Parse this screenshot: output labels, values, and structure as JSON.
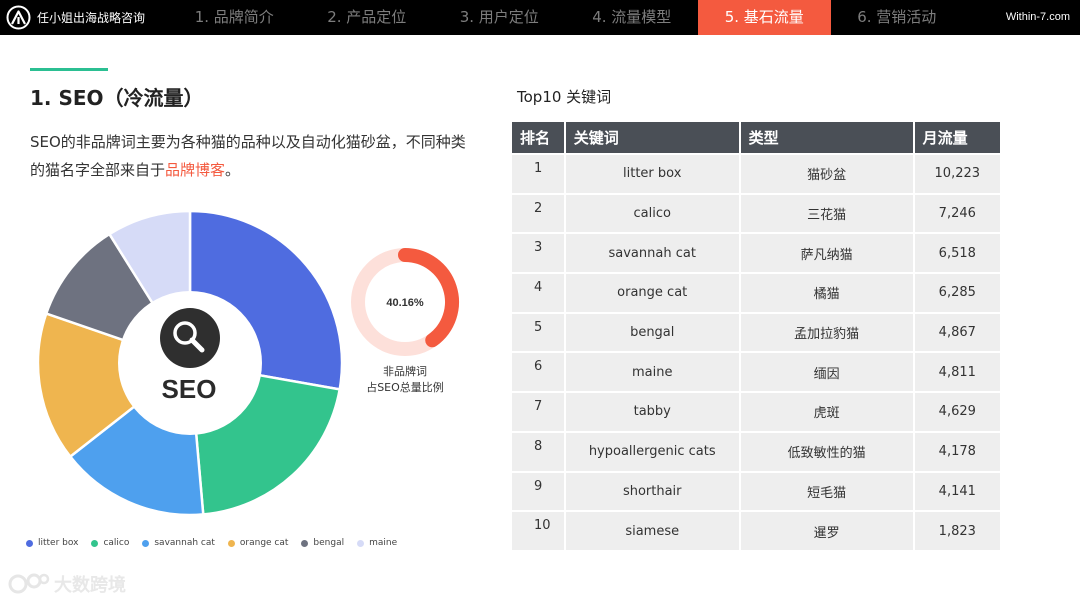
{
  "header": {
    "brand": "任小姐出海战略咨询",
    "site": "Within-7.com",
    "nav": [
      {
        "label": "1. 品牌简介",
        "active": false
      },
      {
        "label": "2. 产品定位",
        "active": false
      },
      {
        "label": "3. 用户定位",
        "active": false
      },
      {
        "label": "4. 流量模型",
        "active": false
      },
      {
        "label": "5. 基石流量",
        "active": true
      },
      {
        "label": "6. 营销活动",
        "active": false
      }
    ]
  },
  "section": {
    "title": "1. SEO（冷流量）",
    "desc_prefix": "SEO的非品牌词主要为各种猫的品种以及自动化猫砂盆，不同种类的猫名字全部来自于",
    "desc_highlight": "品牌博客",
    "desc_suffix": "。"
  },
  "donut": {
    "center_label": "SEO",
    "center_icon": "search-icon",
    "legend": [
      {
        "name": "litter box",
        "color": "#4f6ce0"
      },
      {
        "name": "calico",
        "color": "#33c48d"
      },
      {
        "name": "savannah cat",
        "color": "#4ea0ee"
      },
      {
        "name": "orange cat",
        "color": "#efb54f"
      },
      {
        "name": "bengal",
        "color": "#6e7280"
      },
      {
        "name": "maine",
        "color": "#d6dbf7"
      }
    ]
  },
  "ratio": {
    "value_label": "40.16%",
    "fraction": 0.4016,
    "line1": "非品牌词",
    "line2": "占SEO总量比例",
    "ring_color": "#f45a3f",
    "track_color": "#fde0da"
  },
  "table": {
    "title": "Top10 关键词",
    "headers": [
      "排名",
      "关键词",
      "类型",
      "月流量"
    ],
    "rows": [
      {
        "rank": "1",
        "keyword": "litter box",
        "type": "猫砂盆",
        "volume": "10,223"
      },
      {
        "rank": "2",
        "keyword": "calico",
        "type": "三花猫",
        "volume": "7,246"
      },
      {
        "rank": "3",
        "keyword": "savannah cat",
        "type": "萨凡纳猫",
        "volume": "6,518"
      },
      {
        "rank": "4",
        "keyword": "orange cat",
        "type": "橘猫",
        "volume": "6,285"
      },
      {
        "rank": "5",
        "keyword": "bengal",
        "type": "孟加拉豹猫",
        "volume": "4,867"
      },
      {
        "rank": "6",
        "keyword": "maine",
        "type": "缅因",
        "volume": "4,811"
      },
      {
        "rank": "7",
        "keyword": "tabby",
        "type": "虎斑",
        "volume": "4,629"
      },
      {
        "rank": "8",
        "keyword": "hypoallergenic cats",
        "type": "低致敏性的猫",
        "volume": "4,178"
      },
      {
        "rank": "9",
        "keyword": "shorthair",
        "type": "短毛猫",
        "volume": "4,141"
      },
      {
        "rank": "10",
        "keyword": "siamese",
        "type": "暹罗",
        "volume": "1,823"
      }
    ]
  },
  "watermark": "大数跨境"
}
